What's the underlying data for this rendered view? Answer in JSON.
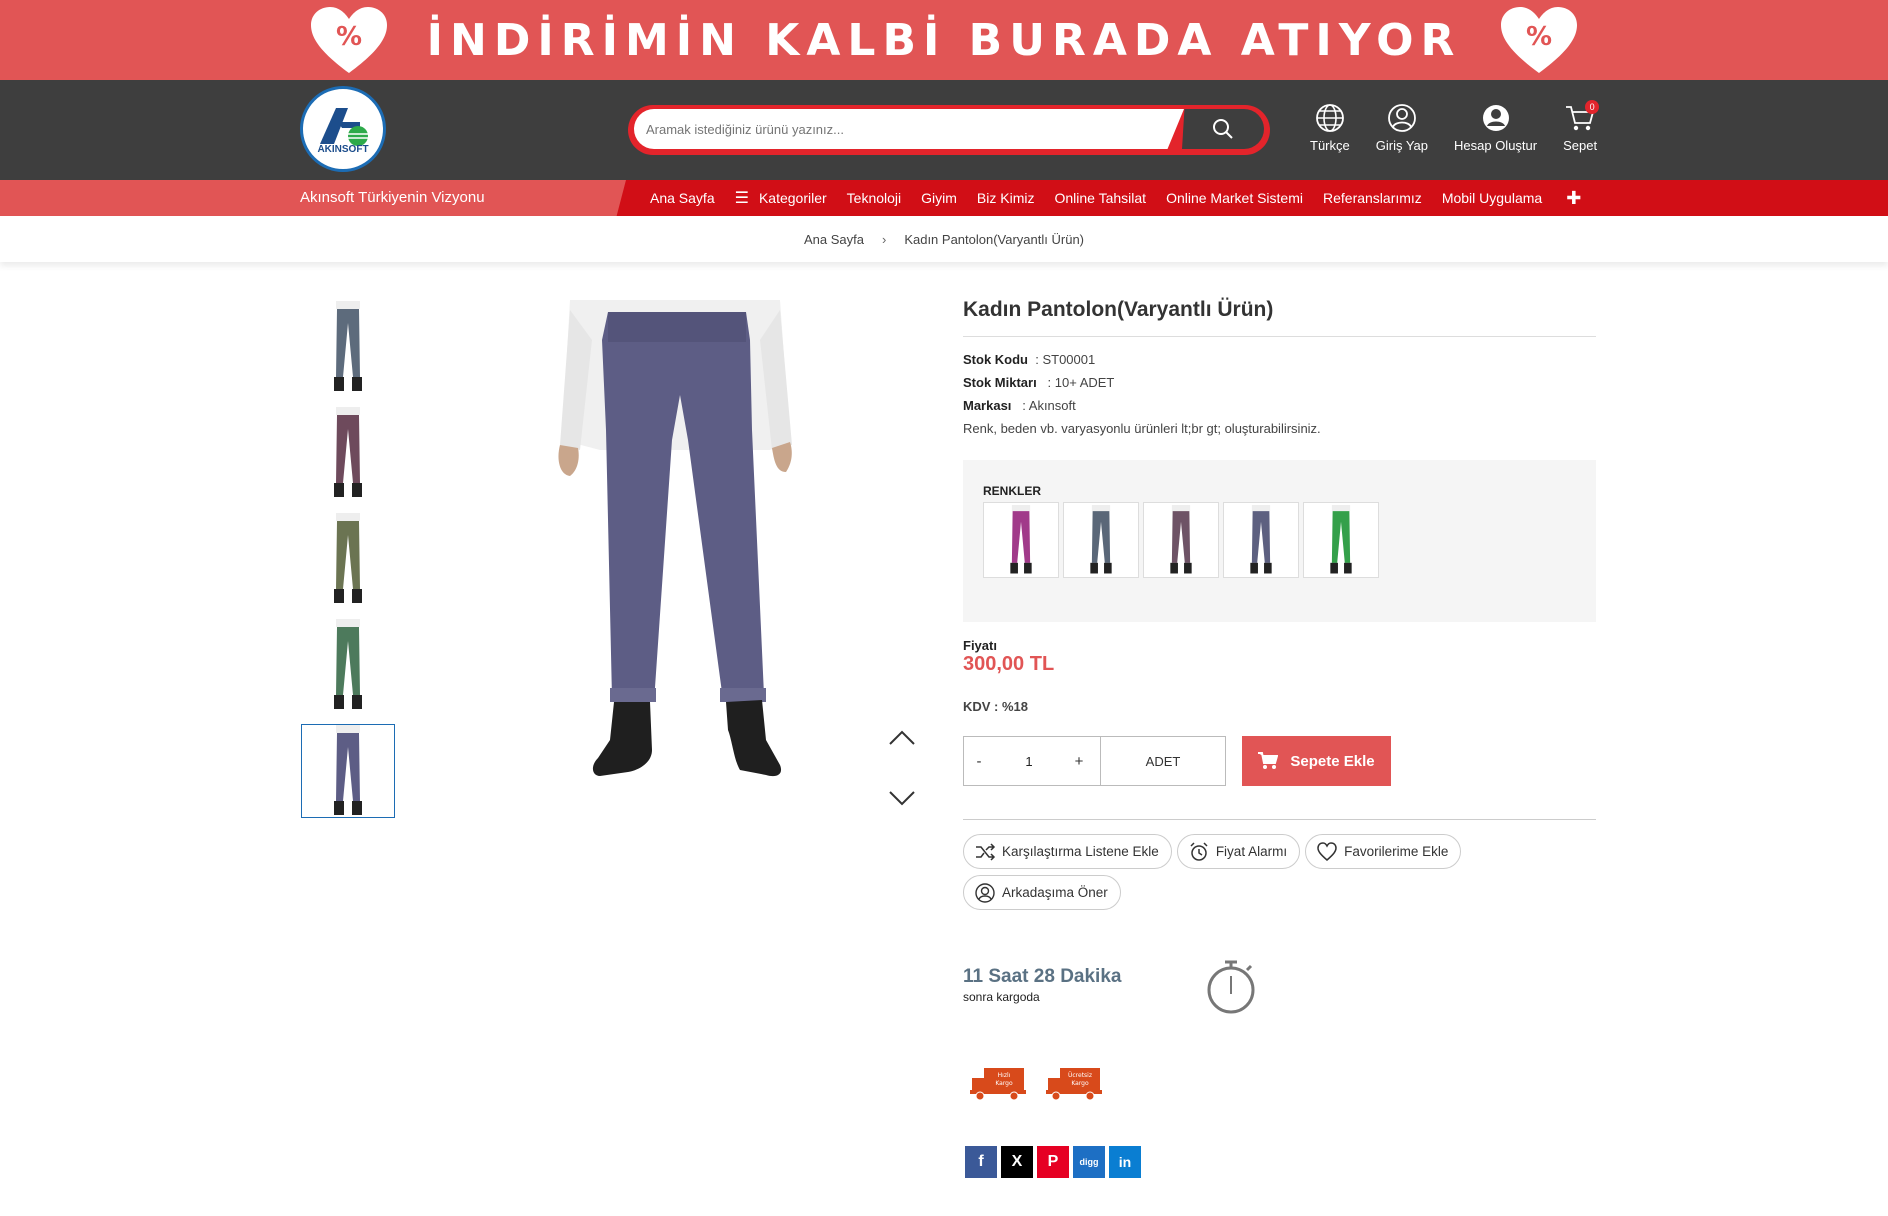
{
  "banner": {
    "text": "İNDİRİMİN KALBİ BURADA ATIYOR",
    "badge_symbol": "%"
  },
  "brand": {
    "logo_text": "AKINSOFT"
  },
  "search": {
    "placeholder": "Aramak istediğiniz ürünü yazınız..."
  },
  "header_links": {
    "language": "Türkçe",
    "login": "Giriş Yap",
    "register": "Hesap Oluştur",
    "cart": "Sepet",
    "cart_count": "0"
  },
  "nav": {
    "slogan": "Akınsoft Türkiyenin Vizyonu",
    "items": [
      "Ana Sayfa",
      "Kategoriler",
      "Teknoloji",
      "Giyim",
      "Biz Kimiz",
      "Online Tahsilat",
      "Online Market Sistemi",
      "Referanslarımız",
      "Mobil Uygulama"
    ],
    "plus": "✚"
  },
  "breadcrumb": {
    "home": "Ana Sayfa",
    "separator": "›",
    "current": "Kadın Pantolon(Varyantlı Ürün)"
  },
  "product": {
    "title": "Kadın Pantolon(Varyantlı Ürün)",
    "stock_code_label": "Stok Kodu",
    "stock_code": ": ST00001",
    "stock_qty_label": "Stok Miktarı",
    "stock_qty": ": 10+ ADET",
    "brand_label": "Markası",
    "brand": ": Akınsoft",
    "description": "Renk, beden vb. varyasyonlu ürünleri lt;br gt; oluşturabilirsiniz.",
    "variant_label": "RENKLER",
    "price_label": "Fiyatı",
    "price": "300,00 TL",
    "kdv": "KDV : %18",
    "qty_minus": "-",
    "qty_value": "1",
    "qty_plus": "+",
    "qty_unit": "ADET",
    "add_to_cart": "Sepete Ekle"
  },
  "colors": {
    "brand_red": "#e15555",
    "nav_red": "#d10e16",
    "header_dark": "#3e3e3e",
    "thumbs": [
      "#5d6b7c",
      "#6e4a5c",
      "#6b7452",
      "#4d7a5c",
      "#5d5d85"
    ],
    "swatches": [
      "#a13a8a",
      "#5a6778",
      "#6e5366",
      "#5d6080",
      "#34a04a"
    ]
  },
  "actions": {
    "compare": "Karşılaştırma Listene Ekle",
    "price_alarm": "Fiyat Alarmı",
    "favorites": "Favorilerime Ekle",
    "recommend": "Arkadaşıma Öner"
  },
  "shipping": {
    "countdown": "11 Saat 28 Dakika",
    "suffix": "sonra kargoda",
    "badge_fast_1": "Hızlı",
    "badge_fast_2": "Kargo",
    "badge_free_1": "Ücretsiz",
    "badge_free_2": "Kargo"
  },
  "social": {
    "facebook": "f",
    "x": "X",
    "pinterest": "P",
    "digg": "digg",
    "linkedin": "in"
  }
}
